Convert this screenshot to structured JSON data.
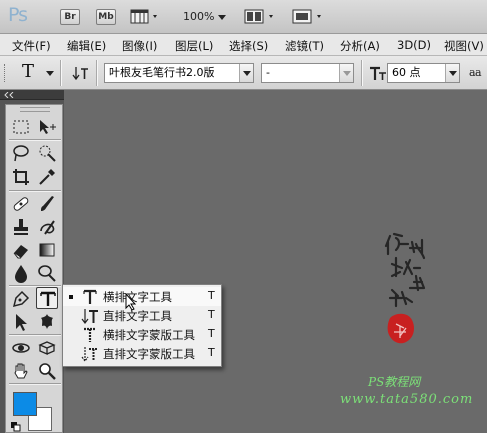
{
  "app": {
    "logo": "Ps",
    "bridge_label": "Br",
    "minibridge_label": "Mb",
    "zoom": "100%"
  },
  "menu": [
    "文件(F)",
    "编辑(E)",
    "图像(I)",
    "图层(L)",
    "选择(S)",
    "滤镜(T)",
    "分析(A)",
    "3D(D)",
    "视图(V)"
  ],
  "options": {
    "tool_glyph": "T",
    "font_family": "叶根友毛笔行书2.0版",
    "font_style": "-",
    "size_glyph": "T",
    "font_size": "60 点",
    "aa_label": "a a"
  },
  "flyout": {
    "items": [
      {
        "label": "横排文字工具",
        "shortcut": "T",
        "icon": "horizontal-type-icon",
        "active": true
      },
      {
        "label": "直排文字工具",
        "shortcut": "T",
        "icon": "vertical-type-icon",
        "active": false
      },
      {
        "label": "横排文字蒙版工具",
        "shortcut": "T",
        "icon": "horizontal-type-mask-icon",
        "active": false
      },
      {
        "label": "直排文字蒙版工具",
        "shortcut": "T",
        "icon": "vertical-type-mask-icon",
        "active": false
      }
    ]
  },
  "watermark": {
    "title": "PS教程网",
    "url": "www.tata580.com"
  },
  "colors": {
    "foreground": "#0c8be6",
    "background": "#ffffff",
    "watermark_text": "#7ce078",
    "seal": "#c82020"
  }
}
